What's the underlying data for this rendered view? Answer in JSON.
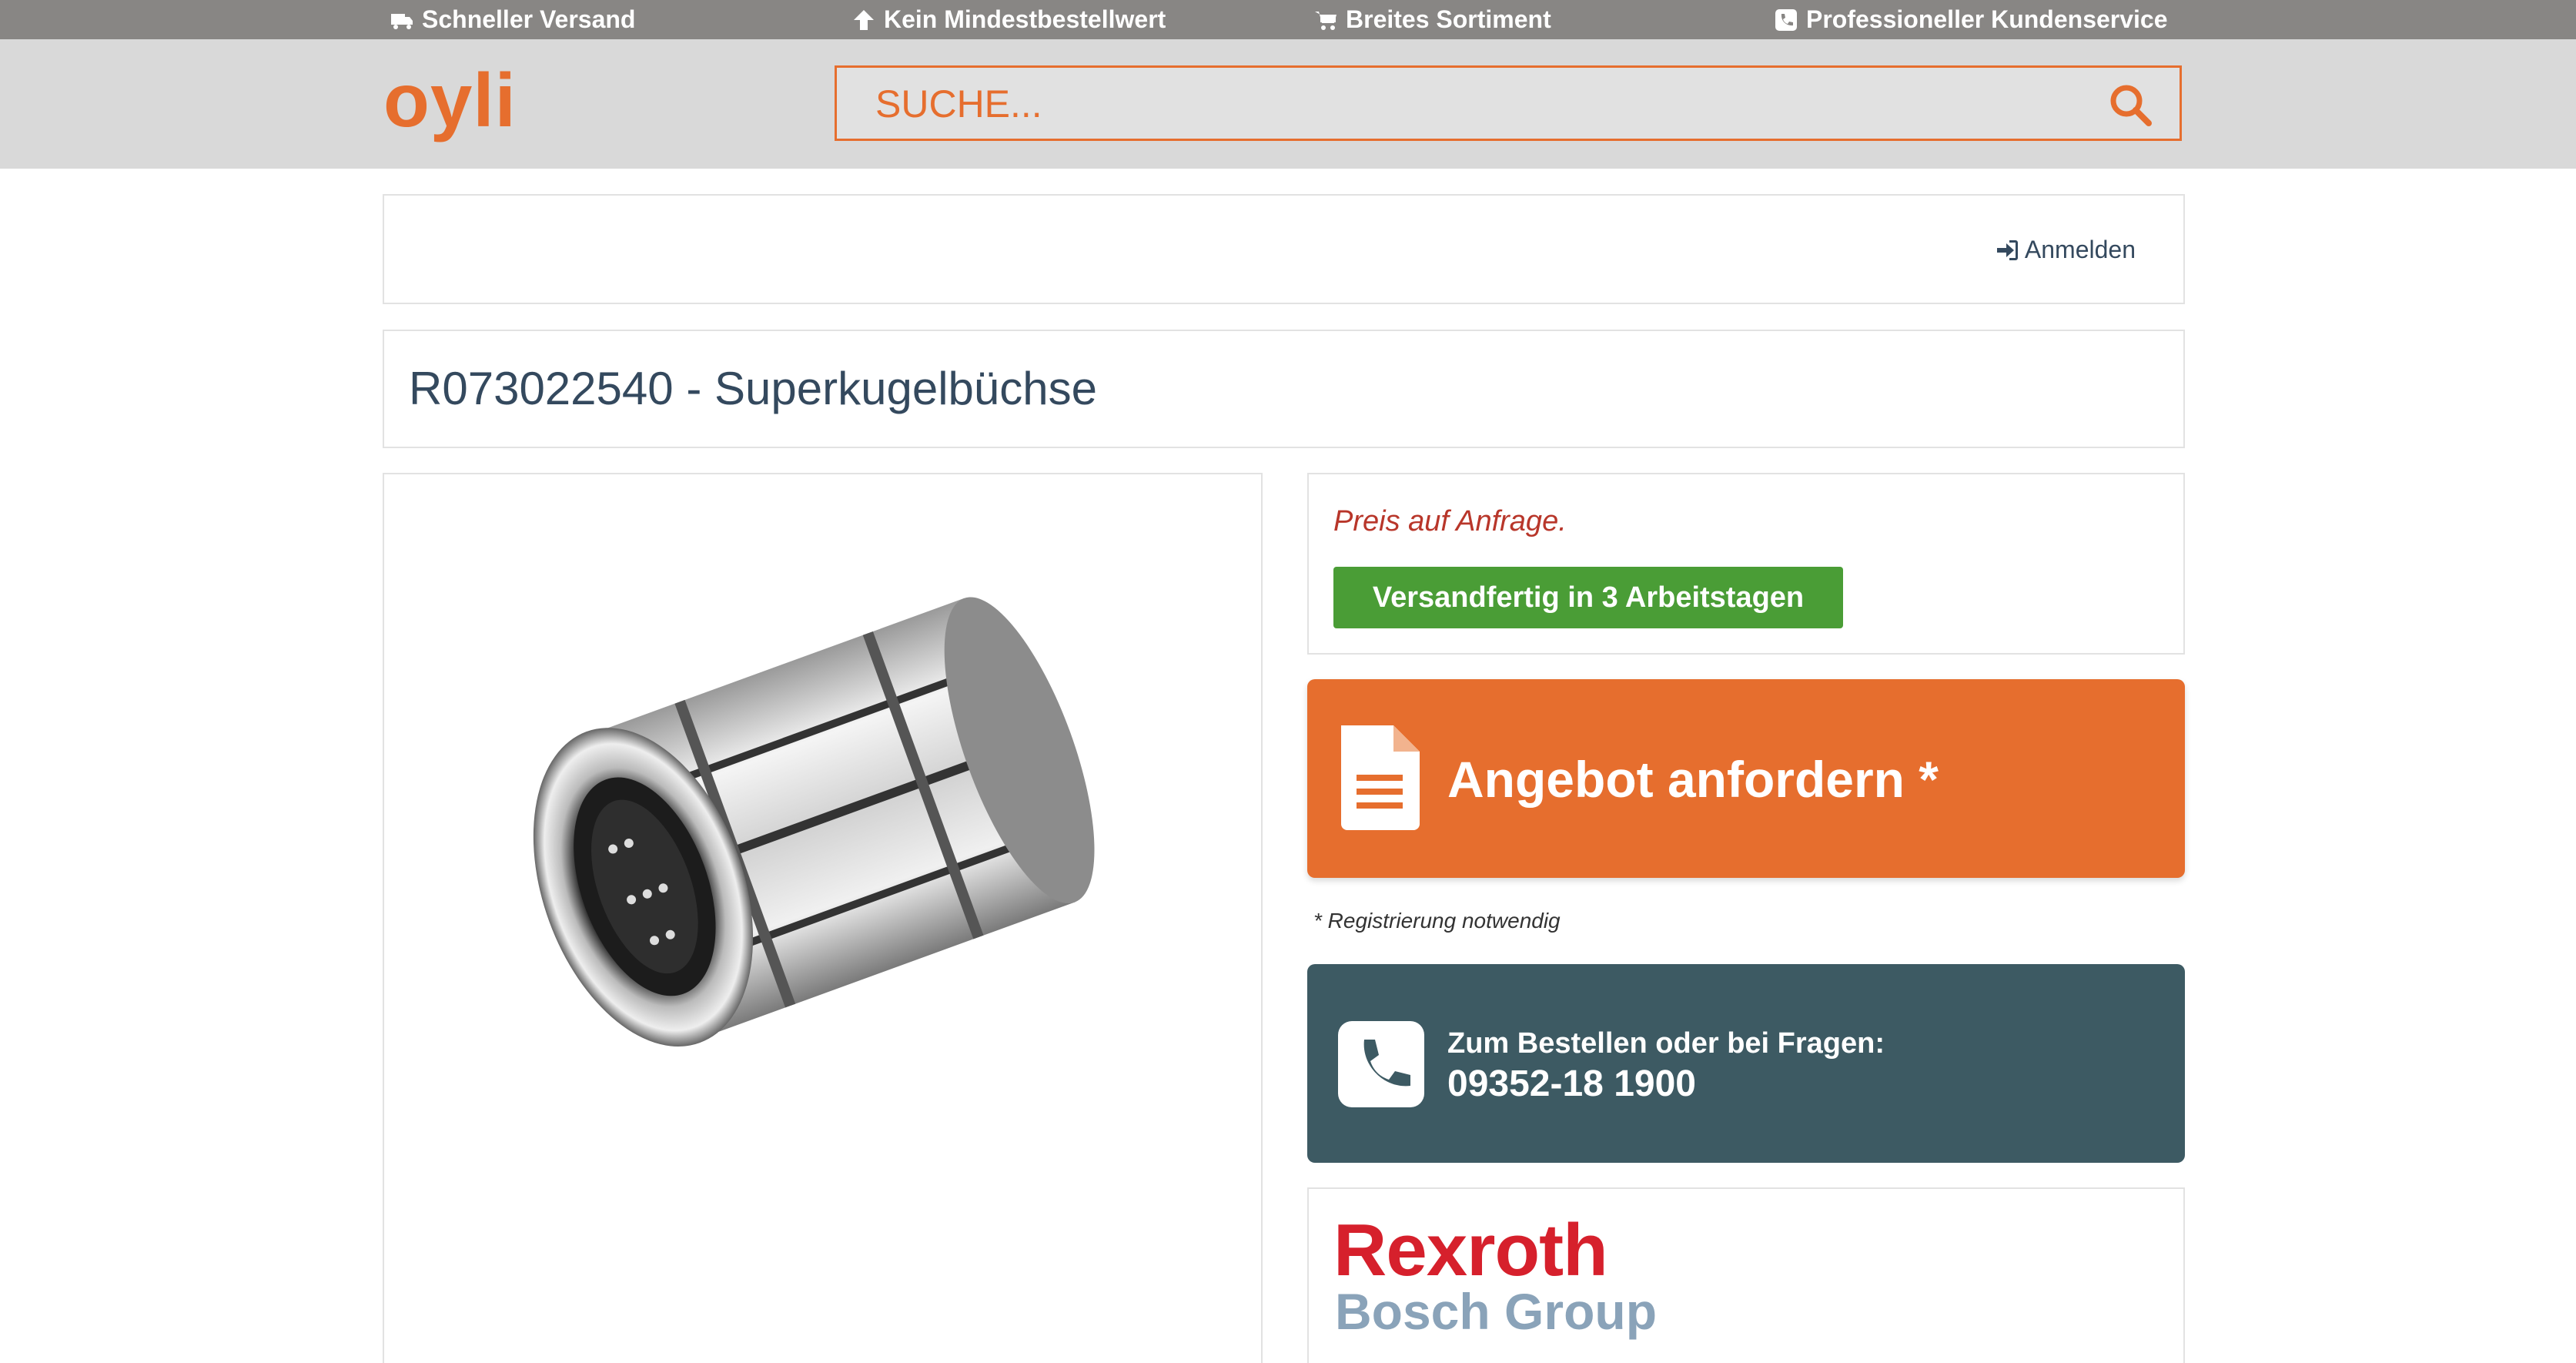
{
  "topbar": {
    "usps": [
      {
        "label": "Schneller Versand",
        "icon": "truck-icon"
      },
      {
        "label": "Kein Mindestbestellwert",
        "icon": "arrow-up-icon"
      },
      {
        "label": "Breites Sortiment",
        "icon": "cart-icon"
      },
      {
        "label": "Professioneller Kundenservice",
        "icon": "phone-square-icon"
      }
    ]
  },
  "header": {
    "logo": "oyli",
    "search_placeholder": "SUCHE...",
    "search_icon": "search-icon",
    "accent_color": "#e66e2e"
  },
  "account": {
    "login_label": "Anmelden",
    "login_icon": "sign-in-icon"
  },
  "product": {
    "title": "R073022540 - Superkugelbüchse",
    "image": "linear-ball-bushing",
    "price_text": "Preis auf Anfrage.",
    "shipping_badge": "Versandfertig in 3 Arbeitstagen",
    "shipping_color": "#4a9d36"
  },
  "offer": {
    "button_label": "Angebot anfordern *",
    "icon": "document-icon",
    "note": "* Registrierung notwendig"
  },
  "contact": {
    "question": "Zum Bestellen oder bei Fragen:",
    "phone": "09352-18 1900",
    "icon": "phone-icon",
    "bg_color": "#3d5a63"
  },
  "brand": {
    "name": "Rexroth",
    "group": "Bosch Group",
    "name_color": "#d6202c"
  }
}
